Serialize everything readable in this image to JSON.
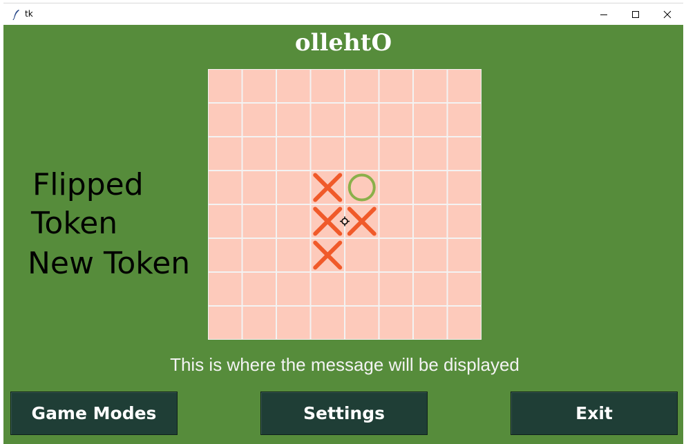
{
  "window": {
    "title": "tk",
    "controls": [
      "minimize-icon",
      "maximize-icon",
      "close-icon"
    ]
  },
  "app": {
    "title": "ollehtO",
    "message": "This is where the message will be displayed",
    "legend": {
      "flipped_label_line1": "Flipped",
      "flipped_label_line2": "Token",
      "new_label": "New Token",
      "flipped_color": "#92cd4e",
      "new_color": "#ed7d31"
    },
    "buttons": {
      "game_modes": "Game Modes",
      "settings": "Settings",
      "exit": "Exit"
    }
  },
  "board": {
    "rows": 8,
    "cols": 8,
    "cell_color": "#fdcabb",
    "grid_color": "#f3f3f3",
    "x_color": "#f05a2a",
    "o_color": "#8ab04a",
    "pieces": [
      {
        "row": 3,
        "col": 3,
        "type": "X"
      },
      {
        "row": 3,
        "col": 4,
        "type": "O"
      },
      {
        "row": 4,
        "col": 3,
        "type": "X"
      },
      {
        "row": 4,
        "col": 4,
        "type": "X"
      },
      {
        "row": 5,
        "col": 3,
        "type": "X"
      }
    ]
  }
}
